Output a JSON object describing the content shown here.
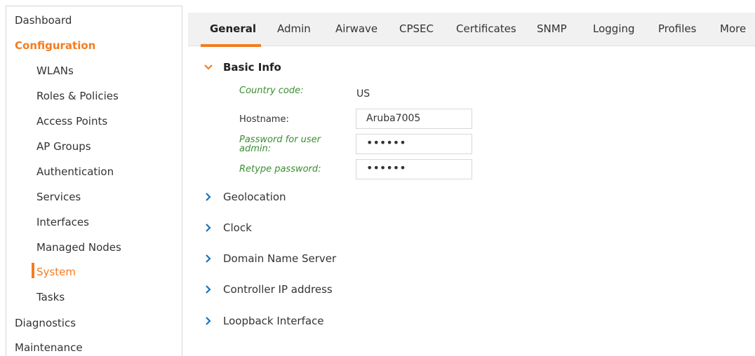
{
  "sidebar": {
    "dashboard": "Dashboard",
    "configuration": "Configuration",
    "sub_items": [
      "WLANs",
      "Roles & Policies",
      "Access Points",
      "AP Groups",
      "Authentication",
      "Services",
      "Interfaces",
      "Managed Nodes",
      "System",
      "Tasks"
    ],
    "diagnostics": "Diagnostics",
    "maintenance": "Maintenance",
    "active_item": "System",
    "accent_color": "#f47c20"
  },
  "tabs": [
    "General",
    "Admin",
    "Airwave",
    "CPSEC",
    "Certificates",
    "SNMP",
    "Logging",
    "Profiles",
    "More"
  ],
  "active_tab": "General",
  "basic_info": {
    "title": "Basic Info",
    "expanded": true,
    "country_code_label": "Country code:",
    "country_code_value": "US",
    "hostname_label": "Hostname:",
    "hostname_value": "Aruba7005",
    "password_label": "Password for user admin:",
    "password_value": "••••••",
    "retype_label": "Retype password:",
    "retype_value": "••••••"
  },
  "collapsed_sections": [
    "Geolocation",
    "Clock",
    "Domain Name Server",
    "Controller IP address",
    "Loopback Interface"
  ],
  "colors": {
    "accent": "#f47c20",
    "chevron": "#1a73b8",
    "field_label_green": "#3a8f2f"
  }
}
